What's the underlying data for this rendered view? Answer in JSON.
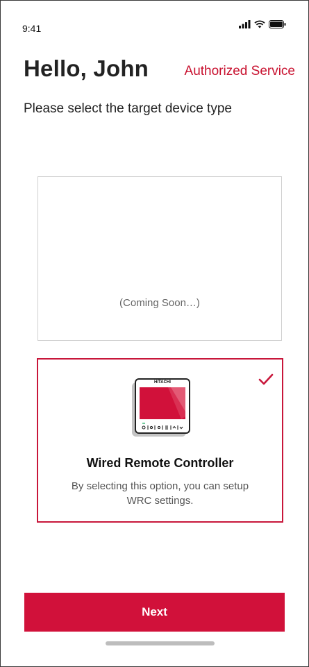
{
  "status": {
    "time": "9:41"
  },
  "header": {
    "greeting": "Hello, John",
    "auth_link": "Authorized Service"
  },
  "subtitle": "Please select the target device type",
  "options": {
    "coming_soon": {
      "label": "(Coming Soon…)"
    },
    "wrc": {
      "brand": "HITACHI",
      "title": "Wired Remote Controller",
      "description": "By selecting this option, you can setup WRC  settings.",
      "selected": true
    }
  },
  "footer": {
    "next_label": "Next"
  },
  "colors": {
    "accent": "#d1113a",
    "border": "#cfcfcf"
  }
}
